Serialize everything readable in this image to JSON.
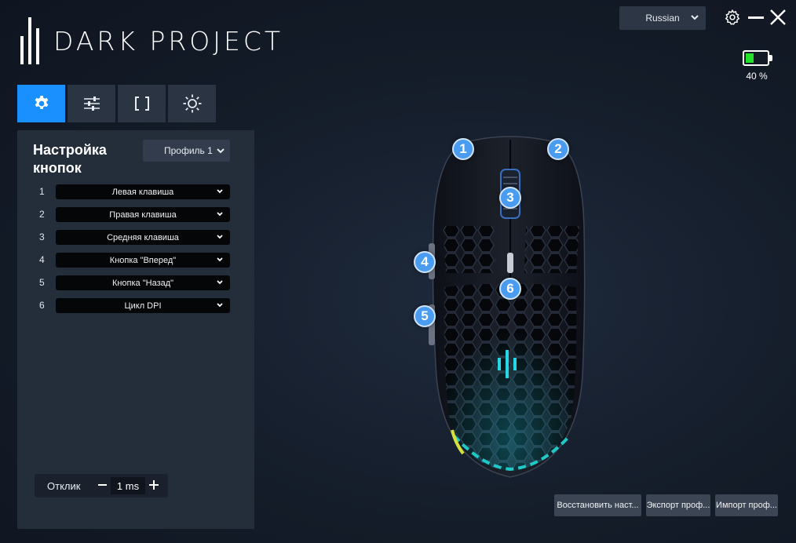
{
  "app": {
    "logo_text": "DARK PROJECT"
  },
  "header": {
    "language": "Russian",
    "battery_level": 0.4,
    "battery_label": "40 %"
  },
  "tabs": [
    {
      "icon": "gear-icon",
      "active": true
    },
    {
      "icon": "sliders-icon",
      "active": false
    },
    {
      "icon": "brackets-icon",
      "active": false
    },
    {
      "icon": "brightness-icon",
      "active": false
    }
  ],
  "panel": {
    "title_line1": "Настройка",
    "title_line2": "кнопок",
    "profile": "Профиль 1",
    "buttons": [
      {
        "num": "1",
        "value": "Левая клавиша"
      },
      {
        "num": "2",
        "value": "Правая клавиша"
      },
      {
        "num": "3",
        "value": "Средняя клавиша"
      },
      {
        "num": "4",
        "value": "Кнопка \"Вперед\""
      },
      {
        "num": "5",
        "value": "Кнопка \"Назад\""
      },
      {
        "num": "6",
        "value": "Цикл DPI"
      }
    ],
    "response_label": "Отклик",
    "response_value": "1 ms"
  },
  "mouse_markers": [
    "1",
    "2",
    "3",
    "4",
    "5",
    "6"
  ],
  "footer": {
    "restore": "Восстановить наст...",
    "export": "Экспорт проф...",
    "import": "Импорт проф..."
  },
  "colors": {
    "accent": "#1a90ff",
    "marker": "#4a9cf0",
    "battery": "#22e22a",
    "panel": "#242d3a"
  }
}
